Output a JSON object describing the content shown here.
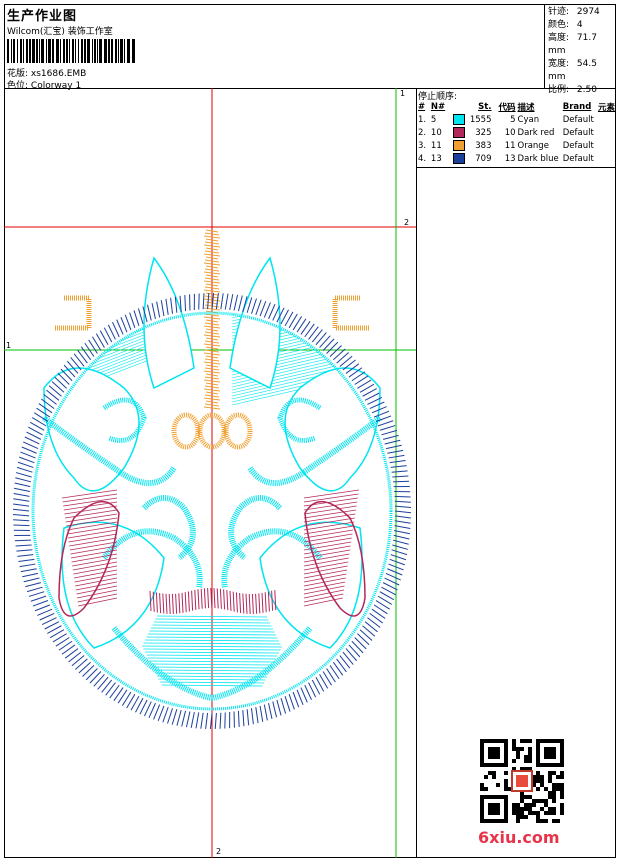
{
  "header": {
    "title": "生产作业图",
    "studio": "Wilcom(汇宝) 装饰工作室",
    "design_label": "花版:",
    "design_value": "xs1686.EMB",
    "color_label": "色位:",
    "color_value": "Colorway 1"
  },
  "stats": [
    {
      "label": "针迹:",
      "value": "2974"
    },
    {
      "label": "颜色:",
      "value": "4"
    },
    {
      "label": "高度:",
      "value": "71.7 mm"
    },
    {
      "label": "宽度:",
      "value": "54.5 mm"
    },
    {
      "label": "比例:",
      "value": "2.50"
    }
  ],
  "sequence": {
    "title": "停止顺序:",
    "headers": [
      "#",
      "N#",
      "St.",
      "代码",
      "描述",
      "Brand",
      "元素"
    ],
    "rows": [
      {
        "num": "1.",
        "n": "5",
        "st": "1555",
        "code": "5",
        "desc": "Cyan",
        "brand": "Default",
        "color": "#00e5f0"
      },
      {
        "num": "2.",
        "n": "10",
        "st": "325",
        "code": "10",
        "desc": "Dark red",
        "brand": "Default",
        "color": "#b3285a"
      },
      {
        "num": "3.",
        "n": "11",
        "st": "383",
        "code": "11",
        "desc": "Orange",
        "brand": "Default",
        "color": "#f0a030"
      },
      {
        "num": "4.",
        "n": "13",
        "st": "709",
        "code": "13",
        "desc": "Dark blue",
        "brand": "Default",
        "color": "#1a3f9c"
      }
    ]
  },
  "canvas": {
    "axis_labels": {
      "top_green": "1",
      "right_red": "2",
      "left_green": "1",
      "bottom_red": "2"
    },
    "colors": {
      "cyan": "#00e5f0",
      "dark_red": "#b3285a",
      "orange": "#f0a030",
      "dark_blue": "#1a3f9c",
      "red_guide": "#e00000",
      "green_guide": "#00c000"
    }
  },
  "watermark": {
    "site": "6xiu.com",
    "qr_icon": "qr-code-icon"
  }
}
